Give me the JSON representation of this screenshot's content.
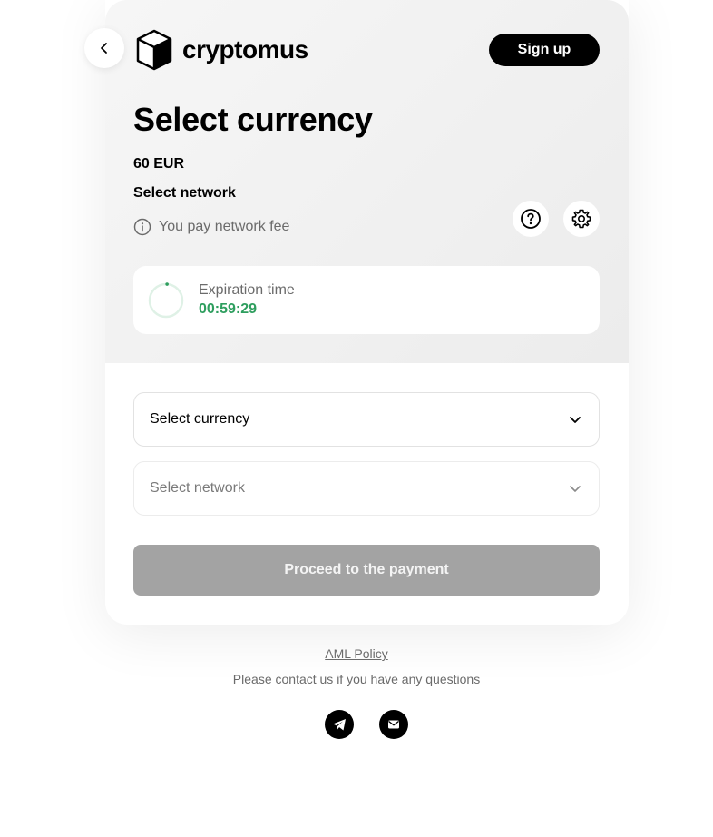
{
  "header": {
    "logo_text": "cryptomus",
    "signup_label": "Sign up"
  },
  "payment": {
    "title": "Select currency",
    "amount": "60 EUR",
    "network_label": "Select network",
    "fee_note": "You pay network fee"
  },
  "expiration": {
    "label": "Expiration time",
    "time": "00:59:29",
    "remaining_fraction": 0.99
  },
  "form": {
    "currency_placeholder": "Select currency",
    "network_placeholder": "Select network",
    "proceed_label": "Proceed to the payment"
  },
  "footer": {
    "aml_label": "AML Policy",
    "contact_text": "Please contact us if you have any questions"
  },
  "icons": {
    "back": "chevron-left-icon",
    "help": "question-circle-icon",
    "settings": "gear-icon",
    "info": "info-circle-icon",
    "chevron": "chevron-down-icon",
    "telegram": "telegram-icon",
    "email": "email-icon"
  },
  "colors": {
    "accent_green": "#2e9e5e",
    "primary_black": "#000000",
    "disabled_button": "#a3a3a3"
  }
}
